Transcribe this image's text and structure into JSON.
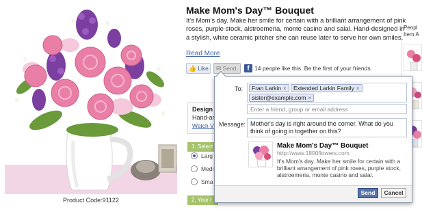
{
  "product": {
    "title": "Make Mom's Day™ Bouquet",
    "description": "It's Mom's day. Make her smile for certain with a brilliant arrangement of pink roses, purple stock, alstroemeria, monte casino and salal. Hand-designed in a stylish, white ceramic pitcher she can reuse later to serve her own smiles.",
    "read_more": "Read More",
    "product_code": "Product Code:91122"
  },
  "like_bar": {
    "like_label": "Like",
    "send_label": "Send",
    "fb_icon": "f",
    "like_count_text": "14 people like this. Be the first of your friends."
  },
  "behind_popup": {
    "design_title": "Design",
    "design_sub": "Hand-ar",
    "design_link": "Watch Vi",
    "step1_label": "1. Select",
    "step2_label": "2. Your r",
    "sizes": [
      "Larg",
      "Medi",
      "Sma"
    ]
  },
  "sidebar": {
    "title_line1": "Peopl",
    "title_line2": "Item A"
  },
  "send_dialog": {
    "to_label": "To:",
    "recipients": [
      {
        "name": "Fran Larkin"
      },
      {
        "name": "Extended Larkin Family"
      },
      {
        "name": "sister@example.com"
      }
    ],
    "remove_symbol": "×",
    "friend_placeholder": "Enter a friend, group or email address",
    "message_label": "Message:",
    "message_text": "Mother's day is right around the corner.  What do you think of going in together on this?",
    "share_title": "Make Mom's Day™ Bouquet",
    "share_url": "http://www.1800flowers.com",
    "share_description": "It's Mom's day. Make her smile for certain with a brilliant arrangement of pink roses, purple stock, alstroemeria, monte casino and salal.",
    "send_button": "Send",
    "cancel_button": "Cancel"
  },
  "colors": {
    "facebook_blue": "#3b5998",
    "link_blue": "#3a5fa0",
    "step_green": "#a6c46b",
    "rose_pink": "#e97fa6",
    "stock_purple": "#7b3fa0"
  }
}
